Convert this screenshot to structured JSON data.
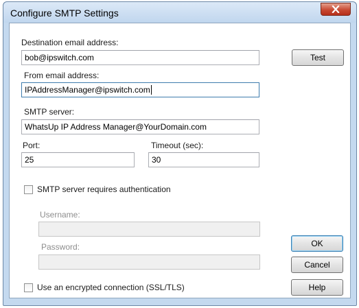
{
  "window": {
    "title": "Configure SMTP Settings"
  },
  "destination": {
    "label": "Destination email address:",
    "value": "bob@ipswitch.com"
  },
  "from": {
    "label": "From email address:",
    "value": "IPAddressManager@ipswitch.com"
  },
  "smtp": {
    "label": "SMTP server:",
    "value": "WhatsUp IP Address Manager@YourDomain.com"
  },
  "port": {
    "label": "Port:",
    "value": "25"
  },
  "timeout": {
    "label": "Timeout (sec):",
    "value": "30"
  },
  "auth": {
    "checkbox_label": "SMTP server requires authentication",
    "checked": false,
    "username_label": "Username:",
    "username_value": "",
    "password_label": "Password:",
    "password_value": ""
  },
  "ssl": {
    "checkbox_label": "Use an encrypted connection (SSL/TLS)",
    "checked": false
  },
  "buttons": {
    "test": "Test",
    "ok": "OK",
    "cancel": "Cancel",
    "help": "Help"
  },
  "icons": {
    "close": "close-icon"
  }
}
